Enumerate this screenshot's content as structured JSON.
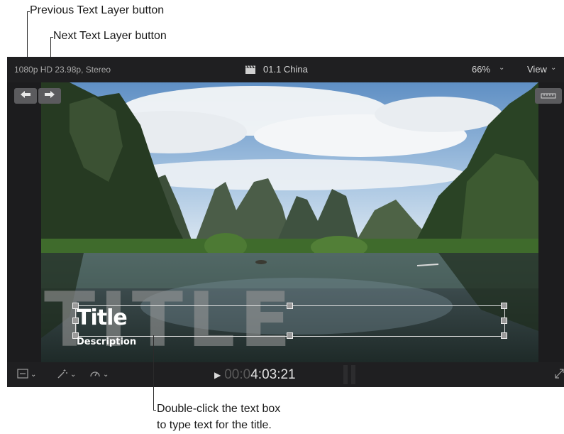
{
  "callouts": {
    "prev_text_layer": "Previous Text Layer button",
    "next_text_layer": "Next Text Layer button",
    "double_click_line1": "Double-click the text box",
    "double_click_line2": "to type text for the title."
  },
  "topbar": {
    "format": "1080p HD 23.98p, Stereo",
    "clip_name": "01.1 China",
    "zoom": "66%",
    "view_label": "View"
  },
  "title_overlay": {
    "background_text": "TITLE",
    "title": "Title",
    "description": "Description"
  },
  "bottombar": {
    "timecode_dim": "00:0",
    "timecode_lit": "4:03:21"
  },
  "icons": {
    "prev": "arrow-left-icon",
    "next": "arrow-right-icon",
    "clip": "clapperboard-icon",
    "transform": "transform-icon",
    "enhance": "magic-wand-icon",
    "speed": "speedometer-icon",
    "play": "play-icon",
    "fullscreen": "fullscreen-icon"
  }
}
